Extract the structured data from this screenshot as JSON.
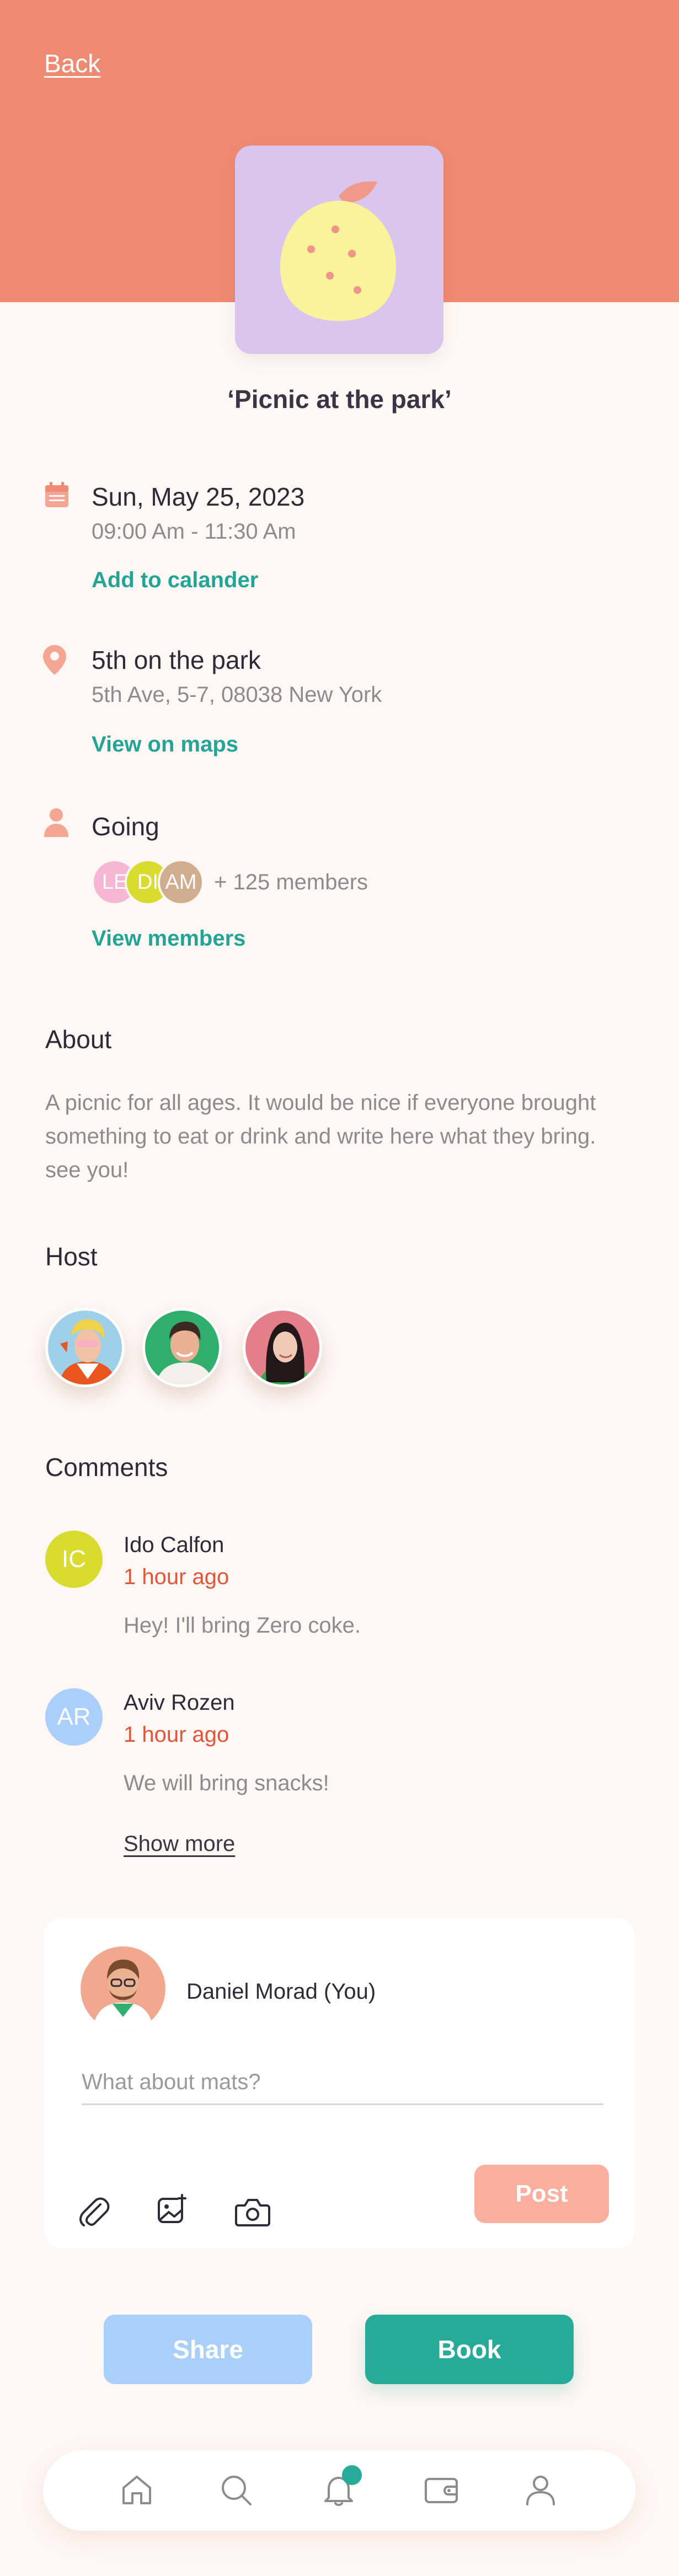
{
  "nav": {
    "back_label": "Back"
  },
  "event": {
    "title": "‘Picnic at the park’",
    "image_icon": "lemon-illustration"
  },
  "date": {
    "icon": "calendar-icon",
    "title": "Sun, May 25, 2023",
    "time": "09:00 Am - 11:30 Am",
    "link": "Add to calander"
  },
  "location": {
    "icon": "map-pin-icon",
    "title": "5th on the park",
    "address": "5th Ave, 5-7, 08038 New York",
    "link": "View on maps"
  },
  "attendance": {
    "icon": "person-icon",
    "title": "Going",
    "avatars": [
      {
        "initials": "LE",
        "color": "#F7B6D3"
      },
      {
        "initials": "DI",
        "color": "#D9DC2F"
      },
      {
        "initials": "AM",
        "color": "#D1AD90"
      }
    ],
    "members_count": "+ 125 members",
    "link": "View members"
  },
  "about": {
    "heading": "About",
    "text": "A picnic for all ages. It would be nice if everyone brought something to eat or drink and write here what they bring. see you!"
  },
  "host": {
    "heading": "Host"
  },
  "comments": {
    "heading": "Comments",
    "items": [
      {
        "initials": "IC",
        "color": "#D9DC2F",
        "name": "Ido Calfon",
        "time": "1 hour ago",
        "text": "Hey! I'll bring Zero coke."
      },
      {
        "initials": "AR",
        "color": "#A9CFFA",
        "name": "Aviv Rozen",
        "time": "1 hour ago",
        "text": "We will bring snacks!"
      }
    ],
    "show_more": "Show more"
  },
  "composer": {
    "user_name": "Daniel Morad (You)",
    "placeholder": "What about mats?",
    "post_label": "Post",
    "tools": [
      "paperclip-icon",
      "image-add-icon",
      "camera-icon"
    ]
  },
  "actions": {
    "share_label": "Share",
    "book_label": "Book"
  },
  "tabbar": {
    "items": [
      "home-icon",
      "search-icon",
      "bell-icon",
      "wallet-icon",
      "profile-icon"
    ]
  },
  "colors": {
    "hero": "#EF8A72",
    "accent": "#26AB99",
    "link": "#22A597",
    "time": "#E2553A",
    "share": "#A9CFFA",
    "post": "#F9AE9E"
  }
}
